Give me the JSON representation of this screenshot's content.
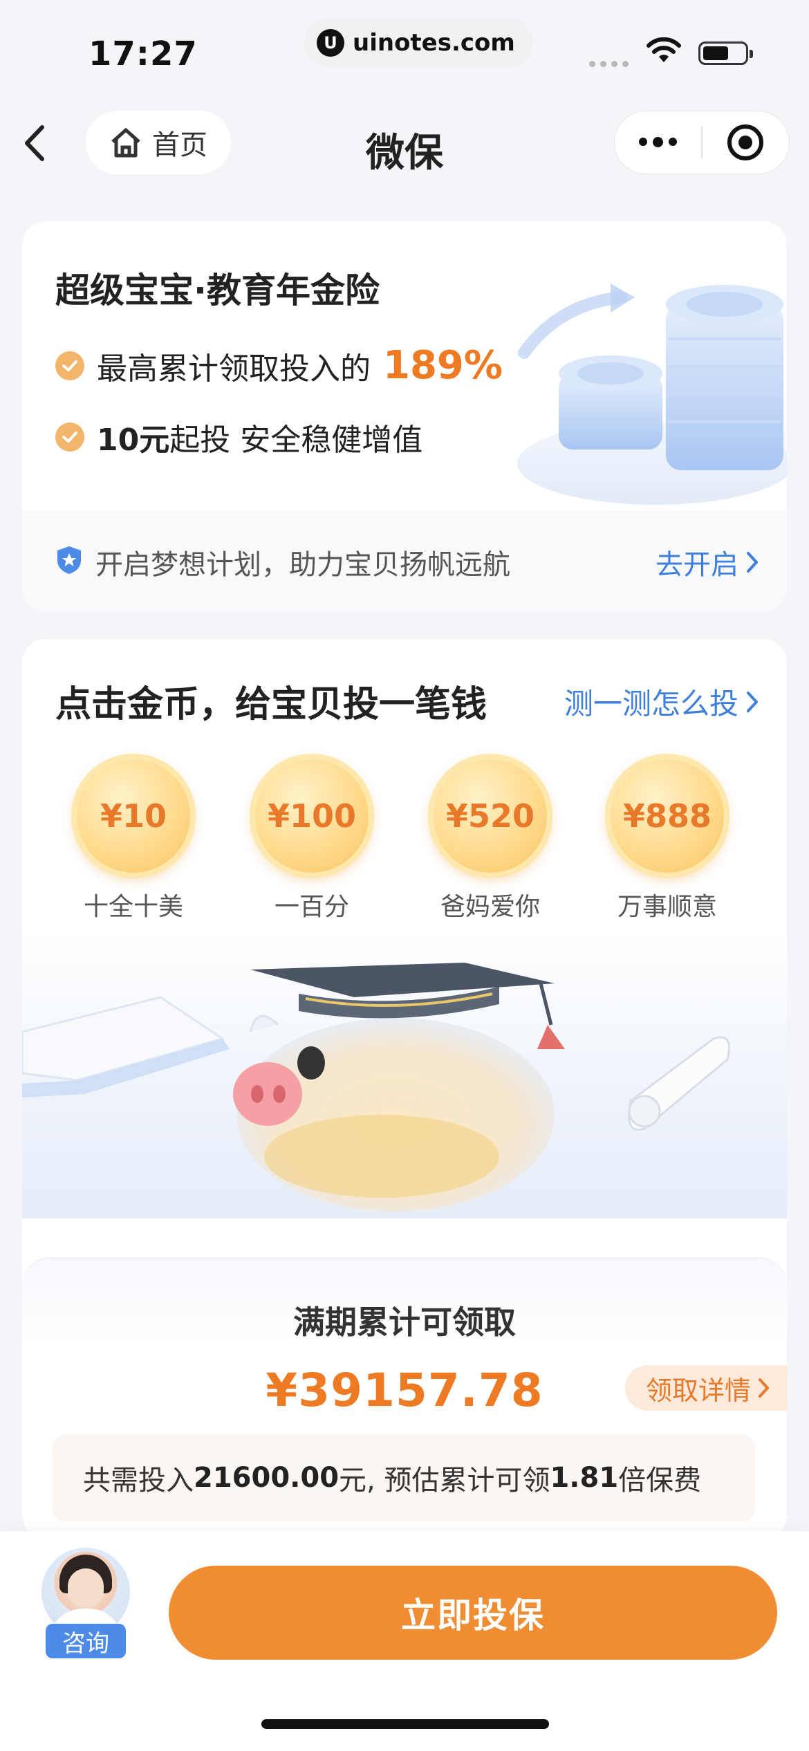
{
  "status_bar": {
    "time": "17:27",
    "url": "uinotes.com",
    "url_logo": "U"
  },
  "nav": {
    "home_label": "首页",
    "title": "微保"
  },
  "product": {
    "title": "超级宝宝·教育年金险",
    "bullet1_text": "最高累计领取投入的",
    "bullet1_pct": "189%",
    "bullet2_bold": "10元",
    "bullet2_text": "起投  安全稳健增值",
    "promo_text": "开启梦想计划，助力宝贝扬帆远航",
    "promo_link": "去开启"
  },
  "invest": {
    "heading": "点击金币，给宝贝投一笔钱",
    "test_link": "测一测怎么投",
    "coins": [
      {
        "amount": "¥10",
        "caption": "十全十美"
      },
      {
        "amount": "¥100",
        "caption": "一百分"
      },
      {
        "amount": "¥520",
        "caption": "爸妈爱你"
      },
      {
        "amount": "¥888",
        "caption": "万事顺意"
      }
    ]
  },
  "payout": {
    "label": "满期累计可领取",
    "amount": "¥39157.78",
    "detail_button": "领取详情",
    "summary_prefix": "共需投入",
    "summary_total": "21600.00",
    "summary_mid": "元, 预估累计可领",
    "summary_multiple": "1.81",
    "summary_suffix": "倍保费"
  },
  "bottom": {
    "advisor_label": "咨询",
    "buy_button": "立即投保"
  },
  "colors": {
    "accent_orange": "#ef7a24",
    "link_blue": "#3f7fdc",
    "button_orange": "#f08c32"
  },
  "icons": [
    "back-icon",
    "home-icon",
    "more-icon",
    "record-icon",
    "check-icon",
    "shield-star-icon",
    "chevron-right-icon"
  ]
}
